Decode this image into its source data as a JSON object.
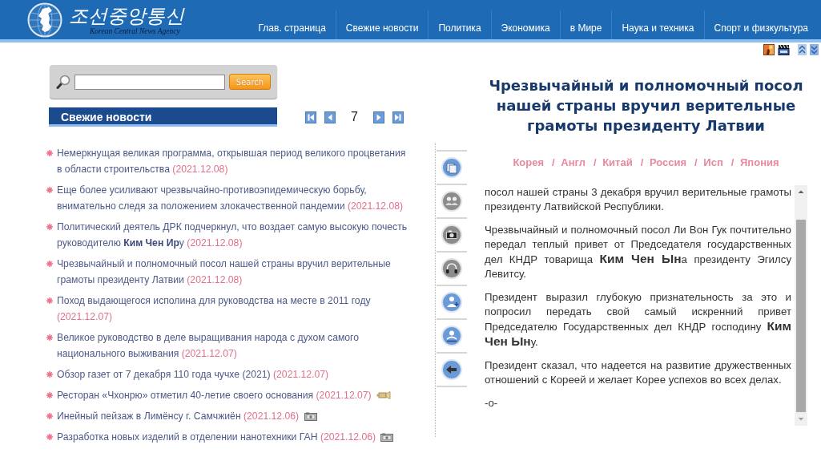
{
  "header": {
    "logo_title": "조선중앙통신",
    "logo_subtitle": "Korean Central News Agency",
    "nav": [
      {
        "label": "Глав. страница"
      },
      {
        "label": "Свежие новости"
      },
      {
        "label": "Политика"
      },
      {
        "label": "Экономика"
      },
      {
        "label": "в Мире"
      },
      {
        "label": "Наука и техника"
      },
      {
        "label": "Спорт и физкультура"
      }
    ]
  },
  "search": {
    "button": "Search"
  },
  "news": {
    "title": "Свежие новости",
    "page": "7",
    "items": [
      {
        "kind": "plain",
        "text": "Немеркнущая великая программа, открывшая период великого процветания в области строительства",
        "date": "(2021.12.08)"
      },
      {
        "kind": "plain",
        "text": "Еще более усиливают чрезвычайно-противоэпидемическую борьбу, внимательно следя за положением злокачественной пандемии",
        "date": "(2021.12.08)"
      },
      {
        "kind": "plain",
        "text": "Политический деятель ДРК подчеркнул, что воздает самую высокую почесть руководителю **Ким Чен Ир**у",
        "date": "(2021.12.08)"
      },
      {
        "kind": "plain",
        "text": "Чрезвычайный и полномочный посол нашей страны вручил верительные грамоты президенту Латвии",
        "date": "(2021.12.08)"
      },
      {
        "kind": "plain",
        "text": "Поход выдающегося исполина для руководства на месте в 2011 году",
        "date": "(2021.12.07)"
      },
      {
        "kind": "plain",
        "text": "Великое руководство в деле выращивания народа с духом самого национального выживания",
        "date": "(2021.12.07)"
      },
      {
        "kind": "plain",
        "text": "Обзор газет от 7 декабря 110 года чучхе (2021)",
        "date": "(2021.12.07)"
      },
      {
        "kind": "video",
        "text": "Ресторан «Чхонрю» отметил 40-летие своего основания",
        "date": "(2021.12.07)"
      },
      {
        "kind": "photo",
        "text": "Инейный пейзаж в Лимёнсу г. Самчжиён",
        "date": "(2021.12.06)"
      },
      {
        "kind": "photo",
        "text": "Разработка новых изделий в отделении нанотехники ГАН",
        "date": "(2021.12.06)"
      }
    ]
  },
  "article": {
    "title": "Чрезвычайный и полномочный посол нашей страны вручил верительные грамоты президенту Латвии",
    "languages": [
      {
        "label": "Корея"
      },
      {
        "separator": "/",
        "label": "Англ"
      },
      {
        "separator": "/",
        "label": "Китай"
      },
      {
        "separator": "/",
        "label": "Россия"
      },
      {
        "separator": "/",
        "label": "Исп"
      },
      {
        "separator": "/",
        "label": "Япония"
      }
    ],
    "paragraphs": [
      "посол нашей страны 3 декабря вручил верительные грамоты президенту Латвийской Республики.",
      "Чрезвычайный и полномочный посол Ли Вон Гук почтительно передал теплый привет от Председателя государственных дел КНДР товарища **Ким Чен Ын**а президенту Эгилсу Левитсу.",
      "Президент выразил глубокую признательность за это и попросил передать свой самый искренний привет Председателю Государственных дел КНДР господину **Ким Чен Ын**у.",
      "Президент сказал, что надеется на развитие дружественных отношений с Кореей и желает Корее успехов во всех делах.",
      "-o-"
    ]
  }
}
